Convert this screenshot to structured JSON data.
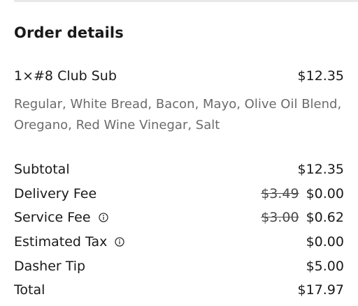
{
  "order": {
    "title": "Order details",
    "item": {
      "quantity": "1×",
      "name": "#8 Club Sub",
      "price": "$12.35",
      "options": "Regular, White Bread, Bacon, Mayo, Olive Oil Blend, Oregano, Red Wine Vinegar, Salt"
    },
    "summary": {
      "subtotal": {
        "label": "Subtotal",
        "value": "$12.35"
      },
      "delivery_fee": {
        "label": "Delivery Fee",
        "original": "$3.49",
        "value": "$0.00"
      },
      "service_fee": {
        "label": "Service Fee",
        "original": "$3.00",
        "value": "$0.62",
        "icon": "info-icon"
      },
      "estimated_tax": {
        "label": "Estimated Tax",
        "value": "$0.00",
        "icon": "info-icon"
      },
      "dasher_tip": {
        "label": "Dasher Tip",
        "value": "$5.00"
      },
      "total": {
        "label": "Total",
        "value": "$17.97"
      }
    }
  }
}
